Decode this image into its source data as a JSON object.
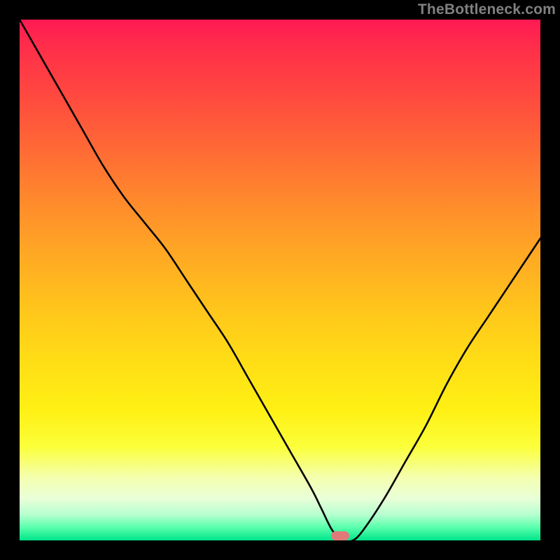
{
  "watermark": "TheBottleneck.com",
  "marker": {
    "x_frac": 0.615,
    "y_frac": 0.991
  },
  "chart_data": {
    "type": "line",
    "title": "",
    "xlabel": "",
    "ylabel": "",
    "xlim": [
      0,
      100
    ],
    "ylim": [
      0,
      100
    ],
    "series": [
      {
        "name": "bottleneck-curve",
        "x": [
          0,
          4,
          8,
          12,
          16,
          20,
          24,
          28,
          32,
          36,
          40,
          44,
          48,
          52,
          56,
          58,
          60,
          62,
          64,
          66,
          70,
          74,
          78,
          82,
          86,
          90,
          94,
          100
        ],
        "y": [
          100,
          93,
          86,
          79,
          72,
          66,
          61,
          56,
          50,
          44,
          38,
          31,
          24,
          17,
          10,
          6,
          2,
          0,
          0,
          2,
          8,
          15,
          22,
          30,
          37,
          43,
          49,
          58
        ]
      }
    ],
    "annotations": [
      {
        "name": "optimal-marker",
        "x": 61.5,
        "y": 0.9
      }
    ],
    "background_gradient": {
      "direction": "vertical",
      "stops": [
        {
          "pos": 0.0,
          "color": "#ff1a53"
        },
        {
          "pos": 0.35,
          "color": "#ff8a2c"
        },
        {
          "pos": 0.65,
          "color": "#ffdc16"
        },
        {
          "pos": 0.88,
          "color": "#f4ffb0"
        },
        {
          "pos": 1.0,
          "color": "#00e58a"
        }
      ]
    }
  }
}
